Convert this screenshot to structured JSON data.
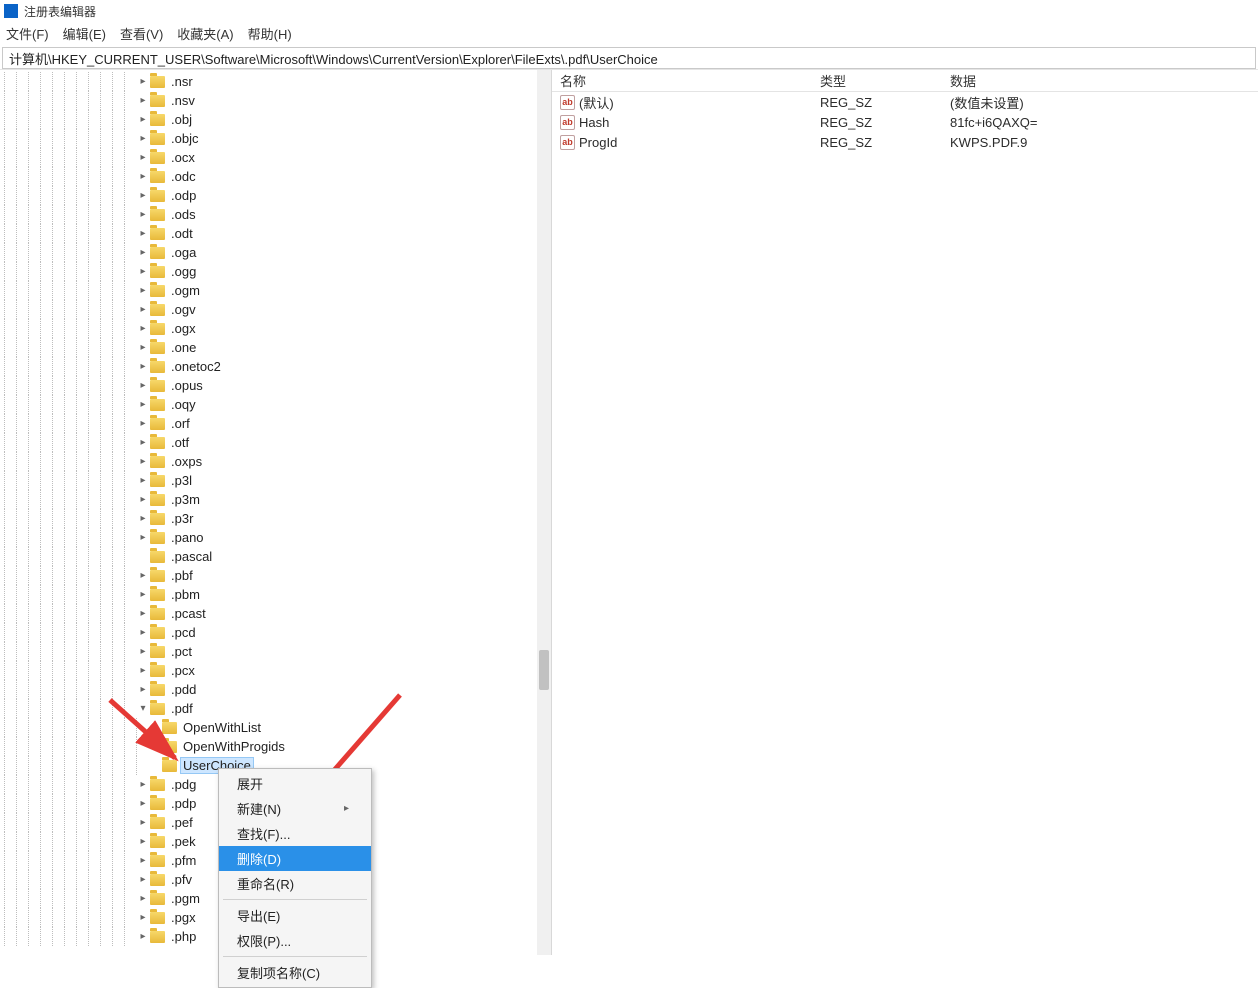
{
  "app": {
    "title": "注册表编辑器"
  },
  "menubar": {
    "file": "文件(F)",
    "edit": "编辑(E)",
    "view": "查看(V)",
    "fav": "收藏夹(A)",
    "help": "帮助(H)"
  },
  "address": "计算机\\HKEY_CURRENT_USER\\Software\\Microsoft\\Windows\\CurrentVersion\\Explorer\\FileExts\\.pdf\\UserChoice",
  "tree": {
    "baseIndent": 12,
    "items": [
      {
        "label": ".nsr",
        "exp": ">"
      },
      {
        "label": ".nsv",
        "exp": ">"
      },
      {
        "label": ".obj",
        "exp": ">"
      },
      {
        "label": ".objc",
        "exp": ">"
      },
      {
        "label": ".ocx",
        "exp": ">"
      },
      {
        "label": ".odc",
        "exp": ">"
      },
      {
        "label": ".odp",
        "exp": ">"
      },
      {
        "label": ".ods",
        "exp": ">"
      },
      {
        "label": ".odt",
        "exp": ">"
      },
      {
        "label": ".oga",
        "exp": ">"
      },
      {
        "label": ".ogg",
        "exp": ">"
      },
      {
        "label": ".ogm",
        "exp": ">"
      },
      {
        "label": ".ogv",
        "exp": ">"
      },
      {
        "label": ".ogx",
        "exp": ">"
      },
      {
        "label": ".one",
        "exp": ">"
      },
      {
        "label": ".onetoc2",
        "exp": ">"
      },
      {
        "label": ".opus",
        "exp": ">"
      },
      {
        "label": ".oqy",
        "exp": ">"
      },
      {
        "label": ".orf",
        "exp": ">"
      },
      {
        "label": ".otf",
        "exp": ">"
      },
      {
        "label": ".oxps",
        "exp": ">"
      },
      {
        "label": ".p3l",
        "exp": ">"
      },
      {
        "label": ".p3m",
        "exp": ">"
      },
      {
        "label": ".p3r",
        "exp": ">"
      },
      {
        "label": ".pano",
        "exp": ">"
      },
      {
        "label": ".pascal",
        "exp": ""
      },
      {
        "label": ".pbf",
        "exp": ">"
      },
      {
        "label": ".pbm",
        "exp": ">"
      },
      {
        "label": ".pcast",
        "exp": ">"
      },
      {
        "label": ".pcd",
        "exp": ">"
      },
      {
        "label": ".pct",
        "exp": ">"
      },
      {
        "label": ".pcx",
        "exp": ">"
      },
      {
        "label": ".pdd",
        "exp": ">"
      },
      {
        "label": ".pdf",
        "exp": "v"
      },
      {
        "label": "OpenWithList",
        "exp": "",
        "child": true
      },
      {
        "label": "OpenWithProgids",
        "exp": "",
        "child": true
      },
      {
        "label": "UserChoice",
        "exp": "",
        "child": true,
        "selected": true
      },
      {
        "label": ".pdg",
        "exp": ">"
      },
      {
        "label": ".pdp",
        "exp": ">"
      },
      {
        "label": ".pef",
        "exp": ">"
      },
      {
        "label": ".pek",
        "exp": ">"
      },
      {
        "label": ".pfm",
        "exp": ">"
      },
      {
        "label": ".pfv",
        "exp": ">"
      },
      {
        "label": ".pgm",
        "exp": ">"
      },
      {
        "label": ".pgx",
        "exp": ">"
      },
      {
        "label": ".php",
        "exp": ">"
      }
    ]
  },
  "values": {
    "headers": {
      "name": "名称",
      "type": "类型",
      "data": "数据"
    },
    "rows": [
      {
        "name": "(默认)",
        "type": "REG_SZ",
        "data": "(数值未设置)"
      },
      {
        "name": "Hash",
        "type": "REG_SZ",
        "data": "81fc+i6QAXQ="
      },
      {
        "name": "ProgId",
        "type": "REG_SZ",
        "data": "KWPS.PDF.9"
      }
    ]
  },
  "context_menu": {
    "items": [
      {
        "label": "展开"
      },
      {
        "label": "新建(N)",
        "submenu": true
      },
      {
        "label": "查找(F)..."
      },
      {
        "label": "删除(D)",
        "hover": true
      },
      {
        "label": "重命名(R)"
      },
      {
        "sep": true
      },
      {
        "label": "导出(E)"
      },
      {
        "label": "权限(P)..."
      },
      {
        "sep": true
      },
      {
        "label": "复制项名称(C)"
      }
    ]
  }
}
